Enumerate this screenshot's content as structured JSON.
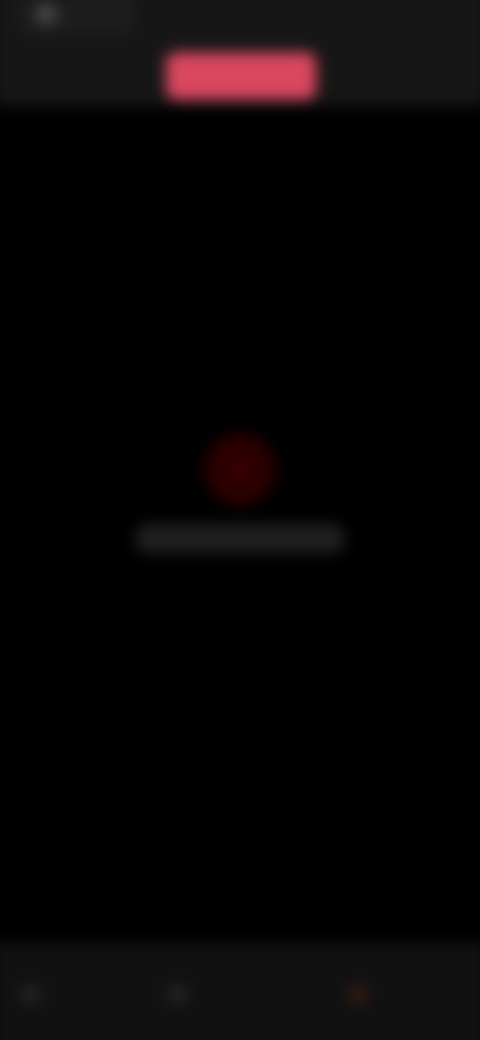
{
  "header": {
    "app_name": "",
    "nav_left_label": "",
    "nav_center_label": "",
    "nav_right_label": ""
  },
  "empty_state": {
    "icon": "alert-icon",
    "message": ""
  },
  "bottom_nav": {
    "left_label": "",
    "center_label": "",
    "right_label": ""
  },
  "colors": {
    "background": "#000000",
    "accent": "#d9475f",
    "status_alert": "#2b0000"
  }
}
